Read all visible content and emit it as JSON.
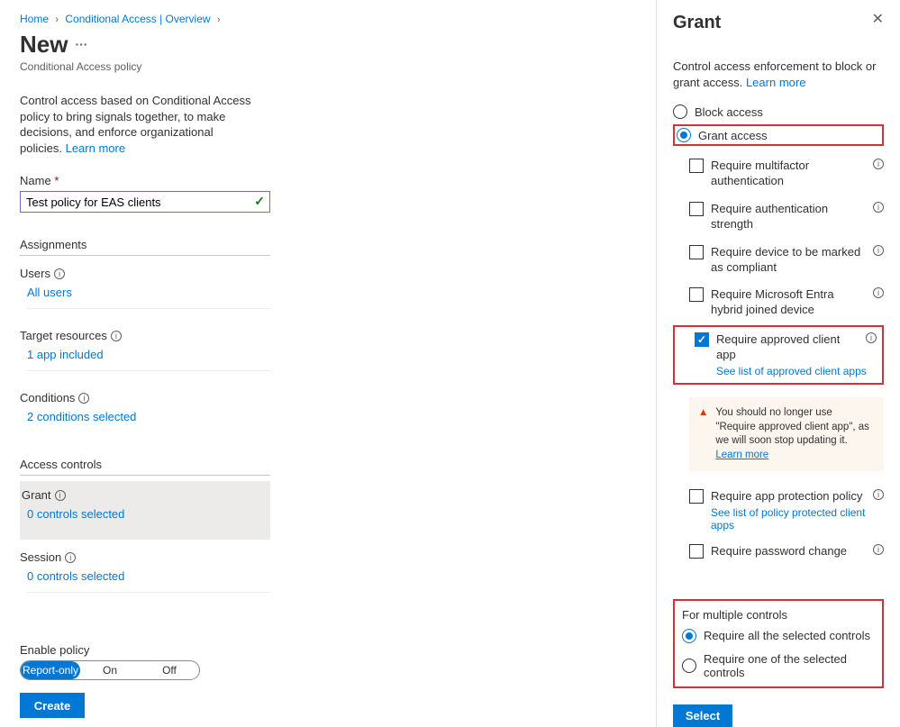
{
  "breadcrumbs": {
    "home": "Home",
    "ca": "Conditional Access | Overview"
  },
  "page": {
    "title": "New",
    "subtitle": "Conditional Access policy"
  },
  "blurb": "Control access based on Conditional Access policy to bring signals together, to make decisions, and enforce organizational policies.",
  "learn_more": "Learn more",
  "name_field": {
    "label": "Name",
    "value": "Test policy for EAS clients"
  },
  "assignments": {
    "heading": "Assignments",
    "users": {
      "label": "Users",
      "value": "All users"
    },
    "target": {
      "label": "Target resources",
      "value": "1 app included"
    },
    "conditions": {
      "label": "Conditions",
      "value": "2 conditions selected"
    }
  },
  "access_controls": {
    "heading": "Access controls",
    "grant": {
      "label": "Grant",
      "value": "0 controls selected"
    },
    "session": {
      "label": "Session",
      "value": "0 controls selected"
    }
  },
  "footer": {
    "enable_label": "Enable policy",
    "opts": {
      "report": "Report-only",
      "on": "On",
      "off": "Off"
    },
    "create": "Create"
  },
  "panel": {
    "title": "Grant",
    "desc": "Control access enforcement to block or grant access.",
    "radios": {
      "block": "Block access",
      "grant": "Grant access"
    },
    "checks": {
      "mfa": "Require multifactor authentication",
      "strength": "Require authentication strength",
      "compliant": "Require device to be marked as compliant",
      "hybrid": "Require Microsoft Entra hybrid joined device",
      "approved": "Require approved client app",
      "approved_link": "See list of approved client apps",
      "app_protect": "Require app protection policy",
      "app_protect_link": "See list of policy protected client apps",
      "pwd": "Require password change"
    },
    "warn": {
      "text": "You should no longer use \"Require approved client app\", as we will soon stop updating it.",
      "learn": "Learn more"
    },
    "multi": {
      "heading": "For multiple controls",
      "all": "Require all the selected controls",
      "one": "Require one of the selected controls"
    },
    "select": "Select"
  }
}
